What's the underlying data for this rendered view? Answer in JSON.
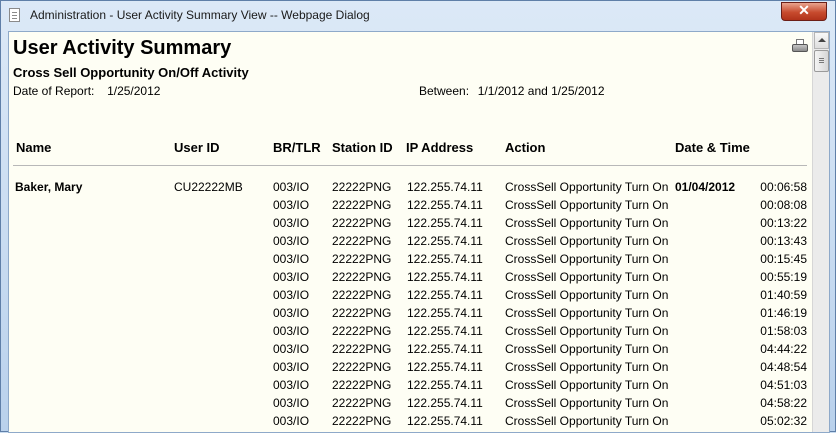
{
  "window": {
    "title": "Administration - User Activity Summary View -- Webpage Dialog",
    "close_label": "✕"
  },
  "report": {
    "title": "User Activity Summary",
    "subtitle": "Cross Sell Opportunity On/Off Activity",
    "date_of_report_label": "Date of Report:",
    "date_of_report": "1/25/2012",
    "between_label": "Between:",
    "between_value": "1/1/2012 and 1/25/2012"
  },
  "table": {
    "headers": {
      "name": "Name",
      "user_id": "User ID",
      "br_tlr": "BR/TLR",
      "station_id": "Station ID",
      "ip_address": "IP Address",
      "action": "Action",
      "date_time": "Date & Time"
    },
    "group": {
      "name": "Baker, Mary",
      "user_id": "CU22222MB",
      "date": "01/04/2012"
    },
    "rows": [
      {
        "br_tlr": "003/IO",
        "station_id": "22222PNG",
        "ip": "122.255.74.11",
        "action": "CrossSell Opportunity Turn On",
        "time": "00:06:58"
      },
      {
        "br_tlr": "003/IO",
        "station_id": "22222PNG",
        "ip": "122.255.74.11",
        "action": "CrossSell Opportunity Turn On",
        "time": "00:08:08"
      },
      {
        "br_tlr": "003/IO",
        "station_id": "22222PNG",
        "ip": "122.255.74.11",
        "action": "CrossSell Opportunity Turn On",
        "time": "00:13:22"
      },
      {
        "br_tlr": "003/IO",
        "station_id": "22222PNG",
        "ip": "122.255.74.11",
        "action": "CrossSell Opportunity Turn On",
        "time": "00:13:43"
      },
      {
        "br_tlr": "003/IO",
        "station_id": "22222PNG",
        "ip": "122.255.74.11",
        "action": "CrossSell Opportunity Turn On",
        "time": "00:15:45"
      },
      {
        "br_tlr": "003/IO",
        "station_id": "22222PNG",
        "ip": "122.255.74.11",
        "action": "CrossSell Opportunity Turn On",
        "time": "00:55:19"
      },
      {
        "br_tlr": "003/IO",
        "station_id": "22222PNG",
        "ip": "122.255.74.11",
        "action": "CrossSell Opportunity Turn On",
        "time": "01:40:59"
      },
      {
        "br_tlr": "003/IO",
        "station_id": "22222PNG",
        "ip": "122.255.74.11",
        "action": "CrossSell Opportunity Turn On",
        "time": "01:46:19"
      },
      {
        "br_tlr": "003/IO",
        "station_id": "22222PNG",
        "ip": "122.255.74.11",
        "action": "CrossSell Opportunity Turn On",
        "time": "01:58:03"
      },
      {
        "br_tlr": "003/IO",
        "station_id": "22222PNG",
        "ip": "122.255.74.11",
        "action": "CrossSell Opportunity Turn On",
        "time": "04:44:22"
      },
      {
        "br_tlr": "003/IO",
        "station_id": "22222PNG",
        "ip": "122.255.74.11",
        "action": "CrossSell Opportunity Turn On",
        "time": "04:48:54"
      },
      {
        "br_tlr": "003/IO",
        "station_id": "22222PNG",
        "ip": "122.255.74.11",
        "action": "CrossSell Opportunity Turn On",
        "time": "04:51:03"
      },
      {
        "br_tlr": "003/IO",
        "station_id": "22222PNG",
        "ip": "122.255.74.11",
        "action": "CrossSell Opportunity Turn On",
        "time": "04:58:22"
      },
      {
        "br_tlr": "003/IO",
        "station_id": "22222PNG",
        "ip": "122.255.74.11",
        "action": "CrossSell Opportunity Turn On",
        "time": "05:02:32"
      }
    ]
  }
}
